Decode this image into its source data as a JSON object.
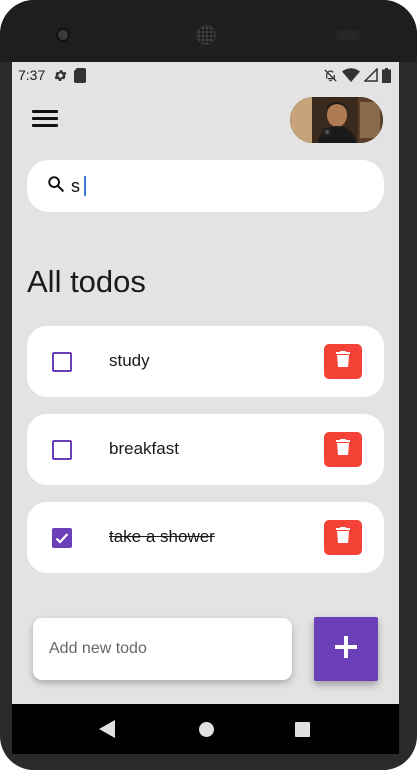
{
  "status_bar": {
    "time": "7:37",
    "icons_left": [
      "gear-icon",
      "sd-card-icon"
    ],
    "icons_right": [
      "do-not-disturb-icon",
      "wifi-icon",
      "cell-signal-icon",
      "battery-icon"
    ]
  },
  "app_bar": {
    "menu_icon": "hamburger-menu-icon",
    "avatar": "user-avatar"
  },
  "search": {
    "icon": "search-icon",
    "value": "s"
  },
  "section_title": "All todos",
  "todos": [
    {
      "label": "study",
      "done": false
    },
    {
      "label": "breakfast",
      "done": false
    },
    {
      "label": "take a shower",
      "done": true
    }
  ],
  "new_todo": {
    "placeholder": "Add new todo"
  },
  "fab": {
    "icon": "plus-icon"
  },
  "nav_bar": {
    "buttons": [
      "back-button",
      "home-button",
      "recents-button"
    ]
  },
  "colors": {
    "accent": "#6b3fb8",
    "delete": "#f44336",
    "background": "#e3e3e3",
    "card": "#ffffff"
  }
}
